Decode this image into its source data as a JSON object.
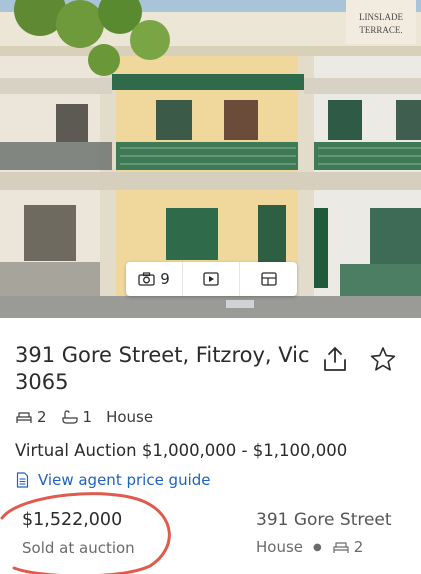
{
  "listing": {
    "address": "391 Gore Street, Fitzroy, Vic 3065",
    "features": {
      "beds": "2",
      "baths": "1",
      "type": "House",
      "bed_icon": "bed-icon",
      "bath_icon": "bath-icon"
    },
    "price": "Virtual Auction $1,000,000 - $1,100,000",
    "price_guide_link": "View agent price guide",
    "share_icon": "share-icon",
    "favorite_icon": "star-icon"
  },
  "photo_controls": {
    "photo_count": "9",
    "camera_icon": "camera-icon",
    "video_icon": "play-icon",
    "floorplan_icon": "floorplan-icon"
  },
  "photo": {
    "sign_line1": "LINSLADE",
    "sign_line2": "TERRACE."
  },
  "sold_result": {
    "price": "$1,522,000",
    "status": "Sold at auction"
  },
  "similar_property": {
    "address": "391 Gore Street",
    "type": "House",
    "beds": "2"
  },
  "colors": {
    "link": "#1d62c4",
    "highlight_ring": "#e05a4e",
    "text": "#2b2b2b"
  }
}
